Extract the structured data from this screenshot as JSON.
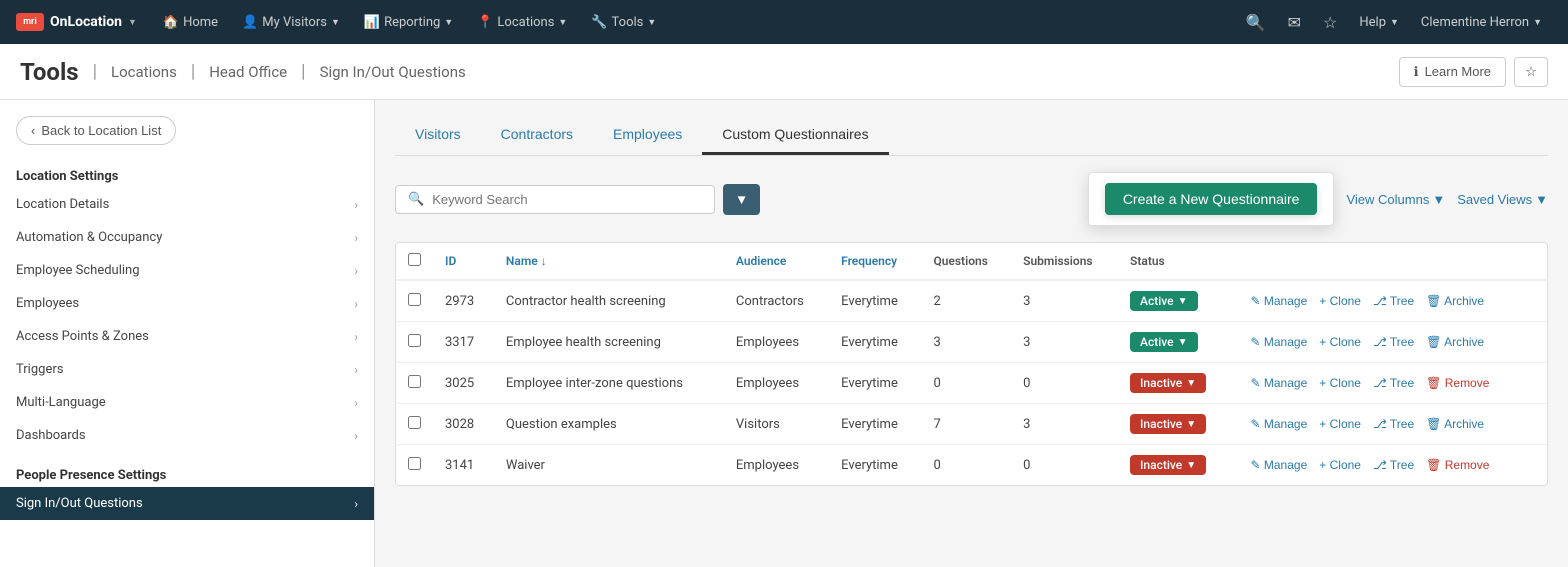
{
  "brand": {
    "logo": "mri",
    "name": "OnLocation"
  },
  "nav": {
    "items": [
      {
        "label": "Home",
        "icon": "home",
        "has_dropdown": false
      },
      {
        "label": "My Visitors",
        "icon": "user",
        "has_dropdown": true
      },
      {
        "label": "Reporting",
        "icon": "chart",
        "has_dropdown": true
      },
      {
        "label": "Locations",
        "icon": "location",
        "has_dropdown": true
      },
      {
        "label": "Tools",
        "icon": "wrench",
        "has_dropdown": true
      }
    ],
    "search_icon": "🔍",
    "mail_icon": "✉",
    "star_icon": "☆",
    "help_label": "Help",
    "user_label": "Clementine Herron"
  },
  "header": {
    "title": "Tools",
    "breadcrumb": [
      "Locations",
      "Head Office",
      "Sign In/Out Questions"
    ],
    "learn_more_label": "Learn More",
    "learn_more_icon": "ℹ"
  },
  "sidebar": {
    "back_label": "Back to Location List",
    "location_settings_title": "Location Settings",
    "location_items": [
      {
        "label": "Location Details",
        "has_chevron": true,
        "active": false
      },
      {
        "label": "Automation & Occupancy",
        "has_chevron": true,
        "active": false
      },
      {
        "label": "Employee Scheduling",
        "has_chevron": true,
        "active": false
      },
      {
        "label": "Employees",
        "has_chevron": true,
        "active": false
      },
      {
        "label": "Access Points & Zones",
        "has_chevron": true,
        "active": false
      },
      {
        "label": "Triggers",
        "has_chevron": true,
        "active": false
      },
      {
        "label": "Multi-Language",
        "has_chevron": true,
        "active": false
      },
      {
        "label": "Dashboards",
        "has_chevron": true,
        "active": false
      }
    ],
    "people_presence_title": "People Presence Settings",
    "people_items": [
      {
        "label": "Sign In/Out Questions",
        "has_chevron": true,
        "active": true
      }
    ]
  },
  "tabs": [
    {
      "label": "Visitors",
      "active": false
    },
    {
      "label": "Contractors",
      "active": false
    },
    {
      "label": "Employees",
      "active": false
    },
    {
      "label": "Custom Questionnaires",
      "active": true
    }
  ],
  "search": {
    "placeholder": "Keyword Search"
  },
  "toolbar": {
    "filter_icon": "▼",
    "create_btn_label": "Create a New Questionnaire",
    "view_columns_label": "View Columns",
    "saved_views_label": "Saved Views"
  },
  "table": {
    "columns": [
      {
        "label": "ID",
        "sortable": true
      },
      {
        "label": "Name",
        "sortable": true,
        "sorted": true,
        "sort_dir": "asc"
      },
      {
        "label": "Audience",
        "sortable": true
      },
      {
        "label": "Frequency",
        "sortable": true
      },
      {
        "label": "Questions",
        "sortable": false
      },
      {
        "label": "Submissions",
        "sortable": false
      },
      {
        "label": "Status",
        "sortable": false
      }
    ],
    "rows": [
      {
        "id": "2973",
        "name": "Contractor health screening",
        "audience": "Contractors",
        "frequency": "Everytime",
        "questions": "2",
        "submissions": "3",
        "status": "Active",
        "status_type": "active",
        "actions": [
          "Manage",
          "Clone",
          "Tree",
          "Archive"
        ]
      },
      {
        "id": "3317",
        "name": "Employee health screening",
        "audience": "Employees",
        "frequency": "Everytime",
        "questions": "3",
        "submissions": "3",
        "status": "Active",
        "status_type": "active",
        "actions": [
          "Manage",
          "Clone",
          "Tree",
          "Archive"
        ]
      },
      {
        "id": "3025",
        "name": "Employee inter-zone questions",
        "audience": "Employees",
        "frequency": "Everytime",
        "questions": "0",
        "submissions": "0",
        "status": "Inactive",
        "status_type": "inactive",
        "actions": [
          "Manage",
          "Clone",
          "Tree",
          "Remove"
        ]
      },
      {
        "id": "3028",
        "name": "Question examples",
        "audience": "Visitors",
        "frequency": "Everytime",
        "questions": "7",
        "submissions": "3",
        "status": "Inactive",
        "status_type": "inactive",
        "actions": [
          "Manage",
          "Clone",
          "Tree",
          "Archive"
        ]
      },
      {
        "id": "3141",
        "name": "Waiver",
        "audience": "Employees",
        "frequency": "Everytime",
        "questions": "0",
        "submissions": "0",
        "status": "Inactive",
        "status_type": "inactive",
        "actions": [
          "Manage",
          "Clone",
          "Tree",
          "Remove"
        ]
      }
    ]
  }
}
